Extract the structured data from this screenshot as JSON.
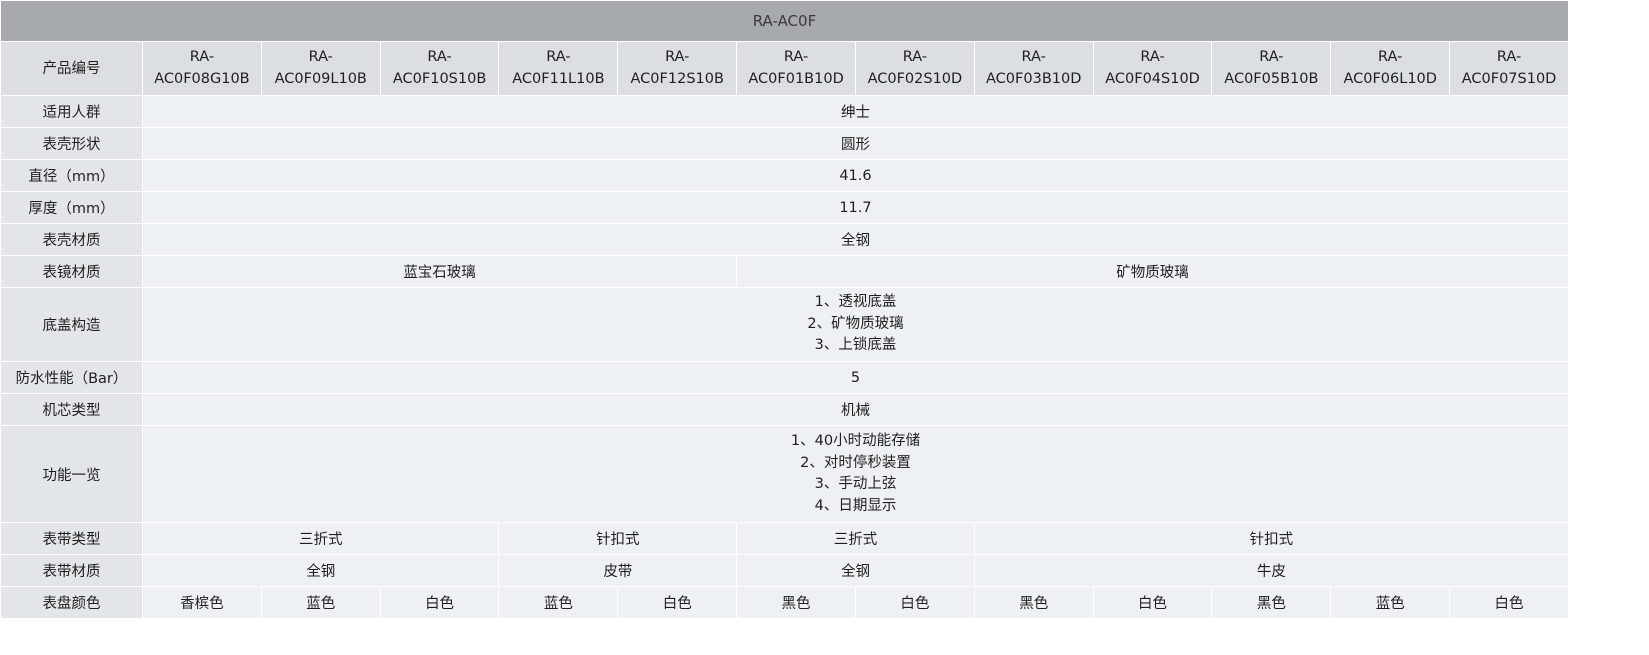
{
  "table": {
    "title": "RA-AC0F",
    "model_label": "产品编号",
    "models": [
      [
        "RA-",
        "AC0F08G10B"
      ],
      [
        "RA-",
        "AC0F09L10B"
      ],
      [
        "RA-",
        "AC0F10S10B"
      ],
      [
        "RA-",
        "AC0F11L10B"
      ],
      [
        "RA-",
        "AC0F12S10B"
      ],
      [
        "RA-",
        "AC0F01B10D"
      ],
      [
        "RA-",
        "AC0F02S10D"
      ],
      [
        "RA-",
        "AC0F03B10D"
      ],
      [
        "RA-",
        "AC0F04S10D"
      ],
      [
        "RA-",
        "AC0F05B10B"
      ],
      [
        "RA-",
        "AC0F06L10D"
      ],
      [
        "RA-",
        "AC0F07S10D"
      ]
    ],
    "target_user": {
      "label": "适用人群",
      "value": "绅士"
    },
    "case_shape": {
      "label": "表壳形状",
      "value": "圆形"
    },
    "diameter": {
      "label": "直径（mm）",
      "value": "41.6"
    },
    "thickness": {
      "label": "厚度（mm）",
      "value": "11.7"
    },
    "case_material": {
      "label": "表壳材质",
      "value": "全钢"
    },
    "crystal": {
      "label": "表镜材质",
      "values": [
        "蓝宝石玻璃",
        "矿物质玻璃"
      ]
    },
    "caseback": {
      "label": "底盖构造",
      "lines": [
        "1、透视底盖",
        "2、矿物质玻璃",
        "3、上锁底盖"
      ]
    },
    "water_resistance": {
      "label": "防水性能（Bar）",
      "value": "5"
    },
    "movement": {
      "label": "机芯类型",
      "value": "机械"
    },
    "functions": {
      "label": "功能一览",
      "lines": [
        "1、40小时动能存储",
        "2、对时停秒装置",
        "3、手动上弦",
        "4、日期显示"
      ]
    },
    "strap_type": {
      "label": "表带类型",
      "values": [
        "三折式",
        "针扣式",
        "三折式",
        "针扣式"
      ]
    },
    "strap_material": {
      "label": "表带材质",
      "values": [
        "全钢",
        "皮带",
        "全钢",
        "牛皮"
      ]
    },
    "dial_color": {
      "label": "表盘颜色",
      "values": [
        "香槟色",
        "蓝色",
        "白色",
        "蓝色",
        "白色",
        "黑色",
        "白色",
        "黑色",
        "白色",
        "黑色",
        "蓝色",
        "白色"
      ]
    }
  }
}
